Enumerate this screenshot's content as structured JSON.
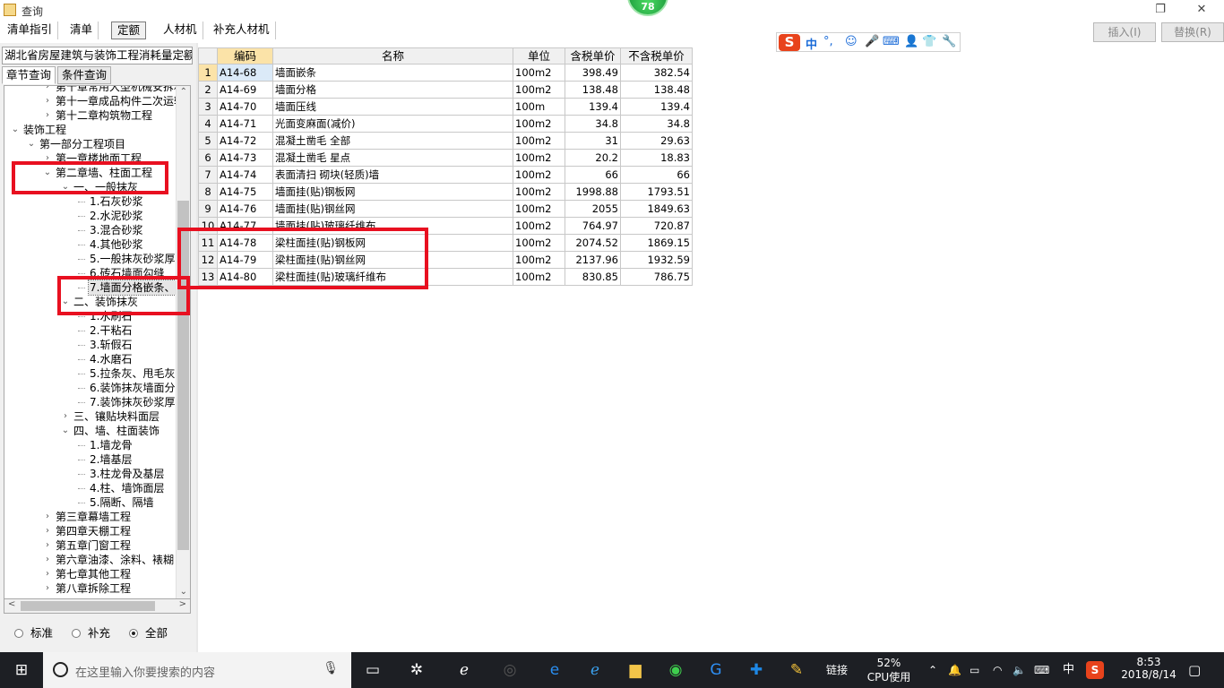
{
  "window": {
    "title": "查询",
    "badge": "78",
    "restore_glyph": "❐",
    "close_glyph": "✕"
  },
  "toolbar": {
    "tabs": [
      "清单指引",
      "清单",
      "定额",
      "人材机",
      "补充人材机"
    ],
    "active": "定额",
    "insert_label": "插入(I)",
    "replace_label": "替换(R)"
  },
  "ime": {
    "logo": "S",
    "mode": "中",
    "punct": "°,",
    "icons": [
      "smile-icon",
      "mic-icon",
      "keyboard-icon",
      "user-icon",
      "shirt-icon",
      "wrench-icon"
    ]
  },
  "left": {
    "library": "湖北省房屋建筑与装饰工程消耗量定额",
    "tabs": [
      "章节查询",
      "条件查询"
    ],
    "tree": [
      {
        "label": "第十章常用大型机械安拆和",
        "level": 2,
        "exp": "collapsed"
      },
      {
        "label": "第十一章成品构件二次运输",
        "level": 2,
        "exp": "collapsed"
      },
      {
        "label": "第十二章构筑物工程",
        "level": 2,
        "exp": "collapsed"
      },
      {
        "label": "装饰工程",
        "level": 0,
        "exp": "expanded"
      },
      {
        "label": "第一部分工程项目",
        "level": 1,
        "exp": "expanded"
      },
      {
        "label": "第一章楼地面工程",
        "level": 2,
        "exp": "collapsed"
      },
      {
        "label": "第二章墙、柱面工程",
        "level": 2,
        "exp": "expanded"
      },
      {
        "label": "一、一般抹灰",
        "level": 3,
        "exp": "expanded"
      },
      {
        "label": "1.石灰砂浆",
        "level": 4,
        "exp": "leaf"
      },
      {
        "label": "2.水泥砂浆",
        "level": 4,
        "exp": "leaf"
      },
      {
        "label": "3.混合砂浆",
        "level": 4,
        "exp": "leaf"
      },
      {
        "label": "4.其他砂浆",
        "level": 4,
        "exp": "leaf"
      },
      {
        "label": "5.一般抹灰砂浆厚",
        "level": 4,
        "exp": "leaf"
      },
      {
        "label": "6.砖石墙面勾缝",
        "level": 4,
        "exp": "leaf"
      },
      {
        "label": "7.墙面分格嵌条、",
        "level": 4,
        "exp": "leaf",
        "selected": true
      },
      {
        "label": "二、装饰抹灰",
        "level": 3,
        "exp": "expanded"
      },
      {
        "label": "1.水刷石",
        "level": 4,
        "exp": "leaf"
      },
      {
        "label": "2.干粘石",
        "level": 4,
        "exp": "leaf"
      },
      {
        "label": "3.斩假石",
        "level": 4,
        "exp": "leaf"
      },
      {
        "label": "4.水磨石",
        "level": 4,
        "exp": "leaf"
      },
      {
        "label": "5.拉条灰、甩毛灰",
        "level": 4,
        "exp": "leaf"
      },
      {
        "label": "6.装饰抹灰墙面分",
        "level": 4,
        "exp": "leaf"
      },
      {
        "label": "7.装饰抹灰砂浆厚",
        "level": 4,
        "exp": "leaf"
      },
      {
        "label": "三、镶贴块料面层",
        "level": 3,
        "exp": "collapsed"
      },
      {
        "label": "四、墙、柱面装饰",
        "level": 3,
        "exp": "expanded"
      },
      {
        "label": "1.墙龙骨",
        "level": 4,
        "exp": "leaf"
      },
      {
        "label": "2.墙基层",
        "level": 4,
        "exp": "leaf"
      },
      {
        "label": "3.柱龙骨及基层",
        "level": 4,
        "exp": "leaf"
      },
      {
        "label": "4.柱、墙饰面层",
        "level": 4,
        "exp": "leaf"
      },
      {
        "label": "5.隔断、隔墙",
        "level": 4,
        "exp": "leaf"
      },
      {
        "label": "第三章幕墙工程",
        "level": 2,
        "exp": "collapsed"
      },
      {
        "label": "第四章天棚工程",
        "level": 2,
        "exp": "collapsed"
      },
      {
        "label": "第五章门窗工程",
        "level": 2,
        "exp": "collapsed"
      },
      {
        "label": "第六章油漆、涂料、裱糊",
        "level": 2,
        "exp": "collapsed"
      },
      {
        "label": "第七章其他工程",
        "level": 2,
        "exp": "collapsed"
      },
      {
        "label": "第八章拆除工程",
        "level": 2,
        "exp": "collapsed"
      }
    ],
    "radios": [
      {
        "label": "标准",
        "checked": false
      },
      {
        "label": "补充",
        "checked": false
      },
      {
        "label": "全部",
        "checked": true
      }
    ]
  },
  "grid": {
    "columns": [
      "",
      "编码",
      "名称",
      "单位",
      "含税单价",
      "不含税单价"
    ],
    "rows": [
      {
        "n": "1",
        "code": "A14-68",
        "name": "墙面嵌条",
        "unit": "100m2",
        "tax": "398.49",
        "notax": "382.54"
      },
      {
        "n": "2",
        "code": "A14-69",
        "name": "墙面分格",
        "unit": "100m2",
        "tax": "138.48",
        "notax": "138.48"
      },
      {
        "n": "3",
        "code": "A14-70",
        "name": "墙面压线",
        "unit": "100m",
        "tax": "139.4",
        "notax": "139.4"
      },
      {
        "n": "4",
        "code": "A14-71",
        "name": "光面变麻面(减价)",
        "unit": "100m2",
        "tax": "34.8",
        "notax": "34.8"
      },
      {
        "n": "5",
        "code": "A14-72",
        "name": "混凝土凿毛 全部",
        "unit": "100m2",
        "tax": "31",
        "notax": "29.63"
      },
      {
        "n": "6",
        "code": "A14-73",
        "name": "混凝土凿毛 星点",
        "unit": "100m2",
        "tax": "20.2",
        "notax": "18.83"
      },
      {
        "n": "7",
        "code": "A14-74",
        "name": "表面清扫 砌块(轻质)墙",
        "unit": "100m2",
        "tax": "66",
        "notax": "66"
      },
      {
        "n": "8",
        "code": "A14-75",
        "name": "墙面挂(贴)钢板网",
        "unit": "100m2",
        "tax": "1998.88",
        "notax": "1793.51"
      },
      {
        "n": "9",
        "code": "A14-76",
        "name": "墙面挂(贴)钢丝网",
        "unit": "100m2",
        "tax": "2055",
        "notax": "1849.63"
      },
      {
        "n": "10",
        "code": "A14-77",
        "name": "墙面挂(贴)玻璃纤维布",
        "unit": "100m2",
        "tax": "764.97",
        "notax": "720.87"
      },
      {
        "n": "11",
        "code": "A14-78",
        "name": "梁柱面挂(贴)钢板网",
        "unit": "100m2",
        "tax": "2074.52",
        "notax": "1869.15"
      },
      {
        "n": "12",
        "code": "A14-79",
        "name": "梁柱面挂(贴)钢丝网",
        "unit": "100m2",
        "tax": "2137.96",
        "notax": "1932.59"
      },
      {
        "n": "13",
        "code": "A14-80",
        "name": "梁柱面挂(贴)玻璃纤维布",
        "unit": "100m2",
        "tax": "830.85",
        "notax": "786.75"
      }
    ]
  },
  "taskbar": {
    "search_placeholder": "在这里输入你要搜索的内容",
    "link_label": "链接",
    "cpu_percent": "52%",
    "cpu_label": "CPU使用",
    "ime_lang": "中",
    "time": "8:53",
    "date": "2018/8/14"
  },
  "colors": {
    "annotation_red": "#e81020",
    "taskbar": "#1d1f24",
    "header_active": "#fbe3a8",
    "selected_cell": "#dbeaf8"
  }
}
